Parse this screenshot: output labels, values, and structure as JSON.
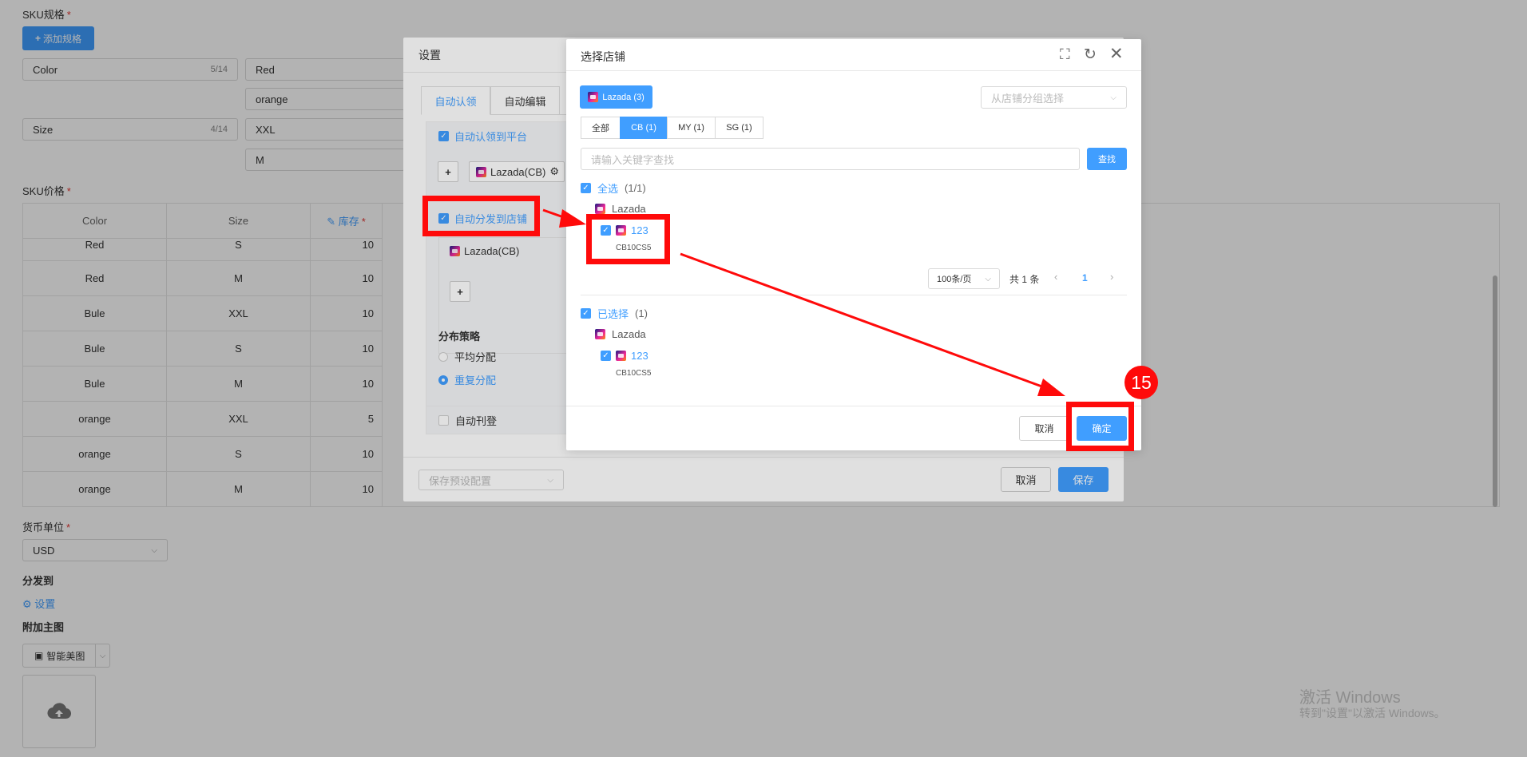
{
  "page": {
    "sku_spec_label": "SKU规格",
    "required_mark": "*",
    "add_spec_button": "添加规格",
    "spec_rows": [
      {
        "name": "Color",
        "count": "5/14",
        "values": [
          "Red",
          "orange"
        ]
      },
      {
        "name": "Size",
        "count": "4/14",
        "values": [
          "XXL",
          "M"
        ]
      }
    ],
    "sku_price_label": "SKU价格",
    "table_headers": {
      "color": "Color",
      "size": "Size",
      "stock": "库存"
    },
    "table_rows": [
      {
        "color": "Red",
        "size": "S",
        "stock": "10"
      },
      {
        "color": "Red",
        "size": "M",
        "stock": "10"
      },
      {
        "color": "Bule",
        "size": "XXL",
        "stock": "10"
      },
      {
        "color": "Bule",
        "size": "S",
        "stock": "10"
      },
      {
        "color": "Bule",
        "size": "M",
        "stock": "10"
      },
      {
        "color": "orange",
        "size": "XXL",
        "stock": "5"
      },
      {
        "color": "orange",
        "size": "S",
        "stock": "10"
      },
      {
        "color": "orange",
        "size": "M",
        "stock": "10"
      }
    ],
    "currency_label": "货币单位",
    "currency_value": "USD",
    "distribute_label": "分发到",
    "settings_link": "设置",
    "extra_image_label": "附加主图",
    "smart_image_button": "智能美图"
  },
  "settings_dialog": {
    "title": "设置",
    "tabs": [
      "自动认领",
      "自动编辑"
    ],
    "auto_claim_platform": "自动认领到平台",
    "platform_chip": "Lazada(CB)",
    "auto_distribute_store": "自动分发到店铺",
    "store_chip": "Lazada(CB)",
    "strategy_label": "分布策略",
    "strategy_options": [
      "平均分配",
      "重复分配"
    ],
    "auto_publish": "自动刊登",
    "preset_placeholder": "保存预设配置",
    "cancel": "取消",
    "save": "保存"
  },
  "store_dialog": {
    "title": "选择店铺",
    "platform_tab": "Lazada (3)",
    "group_placeholder": "从店铺分组选择",
    "region_tabs": [
      "全部",
      "CB (1)",
      "MY (1)",
      "SG (1)"
    ],
    "active_region": "CB (1)",
    "search_placeholder": "请输入关键字查找",
    "search_button": "查找",
    "select_all": "全选",
    "select_all_count": "(1/1)",
    "group_name": "Lazada",
    "store_name": "123",
    "store_code": "CB10CS5",
    "page_size": "100条/页",
    "total": "共 1 条",
    "current_page": "1",
    "selected_label": "已选择",
    "selected_count": "(1)",
    "selected_group": "Lazada",
    "selected_store_name": "123",
    "selected_store_code": "CB10CS5",
    "cancel": "取消",
    "confirm": "确定"
  },
  "annotation": {
    "step_number": "15",
    "highlight_color": "#ff0a0a"
  },
  "watermark": {
    "line1": "激活 Windows",
    "line2": "转到\"设置\"以激活 Windows。"
  },
  "colors": {
    "primary": "#409eff",
    "required": "#e53935",
    "annotation_red": "#ff0a0a"
  }
}
